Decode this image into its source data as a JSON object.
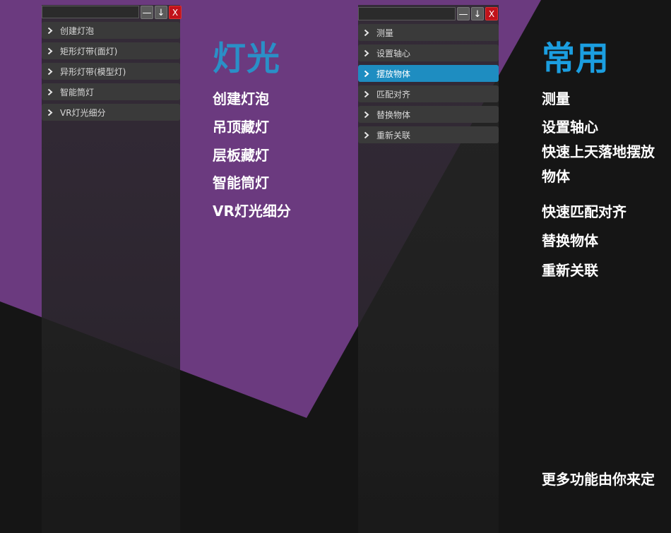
{
  "colors": {
    "purple": "#6b3a7f",
    "dark": "#151515",
    "panel": "#2a2a2a",
    "item": "#3a3a3a",
    "accent": "#1e8dc1",
    "close_red": "#c1121a"
  },
  "left_panel": {
    "search_value": "",
    "buttons": {
      "minimize": "—",
      "pin": "↓",
      "close": "X"
    },
    "items": [
      {
        "label": "创建灯泡"
      },
      {
        "label": "矩形灯带(面灯)"
      },
      {
        "label": "异形灯带(模型灯)"
      },
      {
        "label": "智能筒灯"
      },
      {
        "label": "VR灯光细分"
      }
    ]
  },
  "right_panel": {
    "search_value": "",
    "buttons": {
      "minimize": "—",
      "pin": "↓",
      "close": "X"
    },
    "items": [
      {
        "label": "测量"
      },
      {
        "label": "设置轴心"
      },
      {
        "label": "摆放物体",
        "active": true
      },
      {
        "label": "匹配对齐"
      },
      {
        "label": "替换物体"
      },
      {
        "label": "重新关联"
      }
    ]
  },
  "lights_section": {
    "title": "灯光",
    "features": [
      "创建灯泡",
      "吊顶藏灯",
      "层板藏灯",
      "智能筒灯",
      "VR灯光细分"
    ]
  },
  "common_section": {
    "title": "常用",
    "features": [
      "测量",
      "设置轴心",
      "快速上天落地摆放物体",
      "快速匹配对齐",
      "替换物体",
      "重新关联"
    ],
    "footer": "更多功能由你来定"
  },
  "icons": {
    "menu_item": "chevron-right-icon"
  }
}
